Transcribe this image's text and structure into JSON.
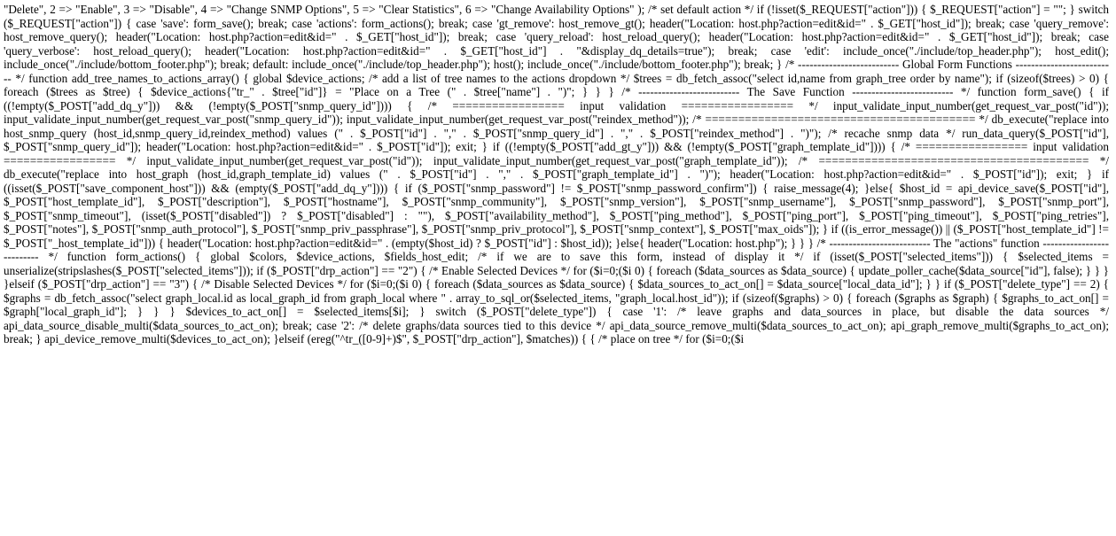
{
  "document": {
    "kind": "raw-php-source-text",
    "font_style": "serif",
    "text_color": "#000000",
    "background_color": "#ffffff",
    "alignment": "justify",
    "body": "\"Delete\", 2 => \"Enable\", 3 => \"Disable\", 4 => \"Change SNMP Options\", 5 => \"Clear Statistics\", 6 => \"Change Availability Options\" ); /* set default action */ if (!isset($_REQUEST[\"action\"])) { $_REQUEST[\"action\"] = \"\"; } switch ($_REQUEST[\"action\"]) { case 'save': form_save(); break; case 'actions': form_actions(); break; case 'gt_remove': host_remove_gt(); header(\"Location: host.php?action=edit&id=\" . $_GET[\"host_id\"]); break; case 'query_remove': host_remove_query(); header(\"Location: host.php?action=edit&id=\" . $_GET[\"host_id\"]); break; case 'query_reload': host_reload_query(); header(\"Location: host.php?action=edit&id=\" . $_GET[\"host_id\"]); break; case 'query_verbose': host_reload_query(); header(\"Location: host.php?action=edit&id=\" . $_GET[\"host_id\"] . \"&display_dq_details=true\"); break; case 'edit': include_once(\"./include/top_header.php\"); host_edit(); include_once(\"./include/bottom_footer.php\"); break; default: include_once(\"./include/top_header.php\"); host(); include_once(\"./include/bottom_footer.php\"); break; } /* -------------------------- Global Form Functions -------------------------- */ function add_tree_names_to_actions_array() { global $device_actions; /* add a list of tree names to the actions dropdown */ $trees = db_fetch_assoc(\"select id,name from graph_tree order by name\"); if (sizeof($trees) > 0) { foreach ($trees as $tree) { $device_actions{\"tr_\" . $tree[\"id\"]} = \"Place on a Tree (\" . $tree[\"name\"] . \")\"; } } } /* -------------------------- The Save Function -------------------------- */ function form_save() { if ((!empty($_POST[\"add_dq_y\"])) && (!empty($_POST[\"snmp_query_id\"]))) { /* ================= input validation ================= */ input_validate_input_number(get_request_var_post(\"id\")); input_validate_input_number(get_request_var_post(\"snmp_query_id\")); input_validate_input_number(get_request_var_post(\"reindex_method\")); /* ========================================= */ db_execute(\"replace into host_snmp_query (host_id,snmp_query_id,reindex_method) values (\" . $_POST[\"id\"] . \",\" . $_POST[\"snmp_query_id\"] . \",\" . $_POST[\"reindex_method\"] . \")\"); /* recache snmp data */ run_data_query($_POST[\"id\"], $_POST[\"snmp_query_id\"]); header(\"Location: host.php?action=edit&id=\" . $_POST[\"id\"]); exit; } if ((!empty($_POST[\"add_gt_y\"])) && (!empty($_POST[\"graph_template_id\"]))) { /* ================= input validation ================= */ input_validate_input_number(get_request_var_post(\"id\")); input_validate_input_number(get_request_var_post(\"graph_template_id\")); /* ========================================= */ db_execute(\"replace into host_graph (host_id,graph_template_id) values (\" . $_POST[\"id\"] . \",\" . $_POST[\"graph_template_id\"] . \")\"); header(\"Location: host.php?action=edit&id=\" . $_POST[\"id\"]); exit; } if ((isset($_POST[\"save_component_host\"])) && (empty($_POST[\"add_dq_y\"]))) { if ($_POST[\"snmp_password\"] != $_POST[\"snmp_password_confirm\"]) { raise_message(4); }else{ $host_id = api_device_save($_POST[\"id\"], $_POST[\"host_template_id\"], $_POST[\"description\"], $_POST[\"hostname\"], $_POST[\"snmp_community\"], $_POST[\"snmp_version\"], $_POST[\"snmp_username\"], $_POST[\"snmp_password\"], $_POST[\"snmp_port\"], $_POST[\"snmp_timeout\"], (isset($_POST[\"disabled\"]) ? $_POST[\"disabled\"] : \"\"), $_POST[\"availability_method\"], $_POST[\"ping_method\"], $_POST[\"ping_port\"], $_POST[\"ping_timeout\"], $_POST[\"ping_retries\"], $_POST[\"notes\"], $_POST[\"snmp_auth_protocol\"], $_POST[\"snmp_priv_passphrase\"], $_POST[\"snmp_priv_protocol\"], $_POST[\"snmp_context\"], $_POST[\"max_oids\"]); } if ((is_error_message()) || ($_POST[\"host_template_id\"] != $_POST[\"_host_template_id\"])) { header(\"Location: host.php?action=edit&id=\" . (empty($host_id) ? $_POST[\"id\"] : $host_id)); }else{ header(\"Location: host.php\"); } } } /* -------------------------- The \"actions\" function -------------------------- */ function form_actions() { global $colors, $device_actions, $fields_host_edit; /* if we are to save this form, instead of display it */ if (isset($_POST[\"selected_items\"])) { $selected_items = unserialize(stripslashes($_POST[\"selected_items\"])); if ($_POST[\"drp_action\"] == \"2\") { /* Enable Selected Devices */ for ($i=0;($i 0) { foreach ($data_sources as $data_source) { update_poller_cache($data_source[\"id\"], false); } } } }elseif ($_POST[\"drp_action\"] == \"3\") { /* Disable Selected Devices */ for ($i=0;($i 0) { foreach ($data_sources as $data_source) { $data_sources_to_act_on[] = $data_source[\"local_data_id\"]; } } if ($_POST[\"delete_type\"] == 2) { $graphs = db_fetch_assoc(\"select graph_local.id as local_graph_id from graph_local where \" . array_to_sql_or($selected_items, \"graph_local.host_id\")); if (sizeof($graphs) > 0) { foreach ($graphs as $graph) { $graphs_to_act_on[] = $graph[\"local_graph_id\"]; } } } $devices_to_act_on[] = $selected_items[$i]; } switch ($_POST[\"delete_type\"]) { case '1': /* leave graphs and data_sources in place, but disable the data sources */ api_data_source_disable_multi($data_sources_to_act_on); break; case '2': /* delete graphs/data sources tied to this device */ api_data_source_remove_multi($data_sources_to_act_on); api_graph_remove_multi($graphs_to_act_on); break; } api_device_remove_multi($devices_to_act_on); }elseif (ereg(\"^tr_([0-9]+)$\", $_POST[\"drp_action\"], $matches)) { { /* place on tree */ for ($i=0;($i"
  }
}
